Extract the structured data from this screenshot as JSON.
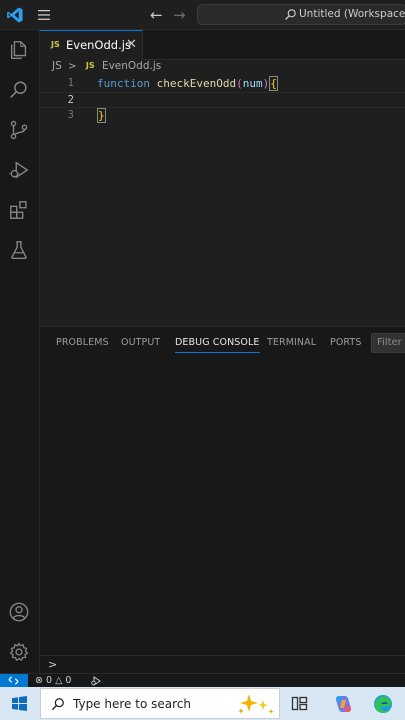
{
  "titlebar": {
    "search_label": "Untitled (Workspace)"
  },
  "tabs": [
    {
      "badge": "JS",
      "label": "EvenOdd.js",
      "close": "✕"
    }
  ],
  "breadcrumb": {
    "folder": "JS",
    "separator": ">",
    "file_badge": "JS",
    "file": "EvenOdd.js"
  },
  "editor": {
    "lines": [
      {
        "number": "1"
      },
      {
        "number": "2"
      },
      {
        "number": "3"
      }
    ],
    "code": {
      "keyword": "function",
      "function_name": "checkEvenOdd",
      "open_paren": "(",
      "param": "num",
      "close_paren": ")",
      "open_brace": "{",
      "close_brace": "}"
    }
  },
  "panel": {
    "tabs": [
      {
        "label": "PROBLEMS"
      },
      {
        "label": "OUTPUT"
      },
      {
        "label": "DEBUG CONSOLE"
      },
      {
        "label": "TERMINAL"
      },
      {
        "label": "PORTS"
      }
    ],
    "active_tab": "DEBUG CONSOLE",
    "filter_placeholder": "Filter (",
    "console_prompt": ">"
  },
  "statusbar": {
    "errors": "0",
    "warnings": "0"
  },
  "taskbar": {
    "search_placeholder": "Type here to search"
  },
  "colors": {
    "accent": "#0078d4",
    "editor_bg": "#1f1f1f",
    "sidebar_bg": "#181818",
    "taskbar_bg": "#d9e6f3"
  }
}
